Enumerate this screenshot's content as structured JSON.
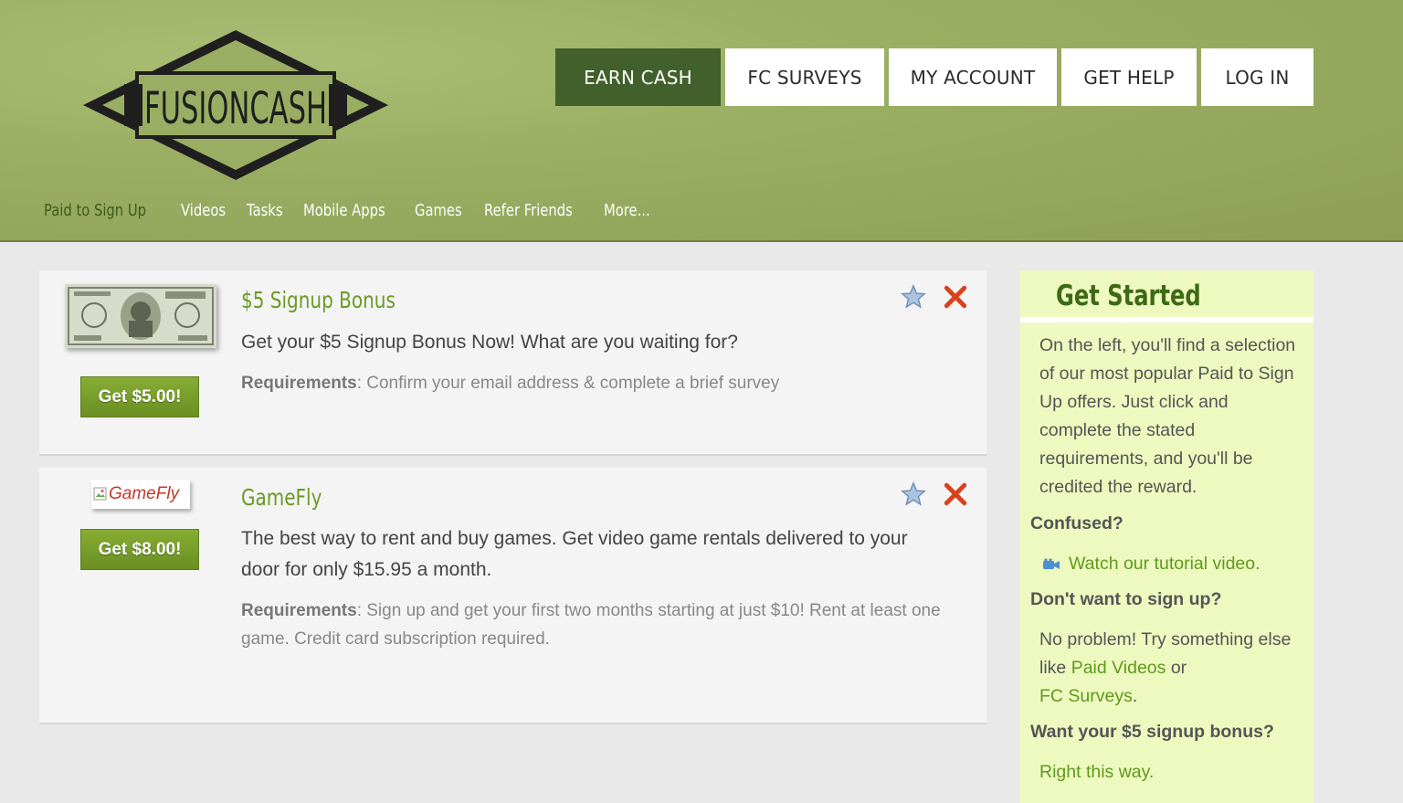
{
  "brand": {
    "logo_text": "FUSIONCASH"
  },
  "top_nav": [
    {
      "label": "EARN CASH",
      "active": true
    },
    {
      "label": "FC SURVEYS",
      "active": false
    },
    {
      "label": "MY ACCOUNT",
      "active": false
    },
    {
      "label": "GET HELP",
      "active": false
    },
    {
      "label": "LOG IN",
      "active": false
    }
  ],
  "sub_nav": [
    {
      "label": "Paid to Sign Up",
      "active": true
    },
    {
      "label": "Videos",
      "active": false
    },
    {
      "label": "Tasks",
      "active": false
    },
    {
      "label": "Mobile Apps",
      "active": false
    },
    {
      "label": "Games",
      "active": false
    },
    {
      "label": "Refer Friends",
      "active": false
    },
    {
      "label": "More...",
      "active": false
    }
  ],
  "offers": [
    {
      "title": "$5 Signup Bonus",
      "button": "Get $5.00!",
      "description": "Get your $5 Signup Bonus Now! What are you waiting for?",
      "requirements_label": "Requirements",
      "requirements": ": Confirm your email address & complete a brief survey"
    },
    {
      "title": "GameFly",
      "image_alt": "GameFly",
      "button": "Get $8.00!",
      "description": "The best way to rent and buy games. Get video game rentals delivered to your door for only $15.95 a month.",
      "requirements_label": "Requirements",
      "requirements": ": Sign up and get your first two months starting at just $10! Rent at least one game. Credit card subscription required."
    }
  ],
  "sidebar": {
    "title": "Get Started",
    "intro": "On the left, you'll find a selection of our most popular Paid to Sign Up offers. Just click and complete the stated requirements, and you'll be credited the reward.",
    "confused_heading": "Confused?",
    "tutorial_link": "Watch our tutorial video.",
    "dont_want_heading": "Don't want to sign up?",
    "alt_text_1": "No problem! Try something else like ",
    "alt_link_videos": "Paid Videos",
    "alt_text_2": " or",
    "alt_link_surveys": "FC Surveys",
    "alt_text_3": ".",
    "bonus_heading": "Want your $5 signup bonus?",
    "bonus_link": "Right this way."
  },
  "colors": {
    "header_green": "#9aae63",
    "active_nav": "#41602b",
    "accent_green": "#6c9a26",
    "button_green": "#7aa02c",
    "close_red": "#d9411e",
    "sidebar_bg": "#eef9c0"
  }
}
